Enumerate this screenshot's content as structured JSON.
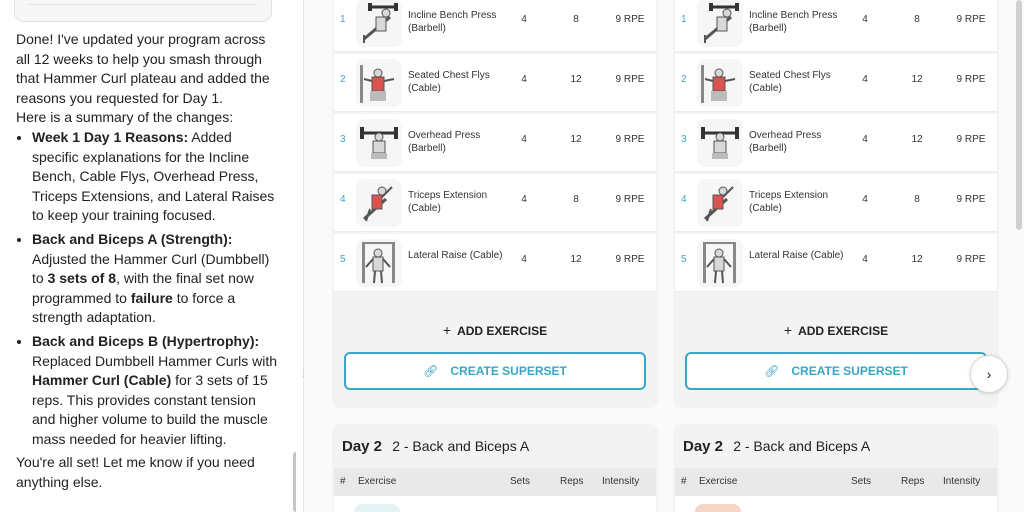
{
  "chat": {
    "intro": "Done! I've updated your program across all 12 weeks to help you smash through that Hammer Curl plateau and added the reasons you requested for Day 1.",
    "summary_lead": "Here is a summary of the changes:",
    "bullets": [
      {
        "title": "Week 1 Day 1 Reasons:",
        "text": " Added specific explanations for the Incline Bench, Cable Flys, Overhead Press, Triceps Extensions, and Lateral Raises to keep your training focused."
      },
      {
        "title": "Back and Biceps A (Strength):",
        "text_a": " Adjusted the Hammer Curl (Dumbbell) to ",
        "bold_a": "3 sets of 8",
        "text_b": ", with the final set now programmed to ",
        "bold_b": "failure",
        "text_c": " to force a strength adaptation."
      },
      {
        "title": "Back and Biceps B (Hypertrophy):",
        "text_a": " Replaced Dumbbell Hammer Curls with ",
        "bold_a": "Hammer Curl (Cable)",
        "text_b": " for 3 sets of 15 reps. This provides constant tension and higher volume to build the muscle mass needed for heavier lifting."
      }
    ],
    "closing": "You're all set! Let me know if you need anything else."
  },
  "columns": [
    {
      "exercises": [
        {
          "num": "1",
          "name": "Incline Bench Press (Barbell)",
          "sets": "4",
          "reps": "8",
          "intensity": "9 RPE",
          "icon": "incline-bench-figure"
        },
        {
          "num": "2",
          "name": "Seated Chest Flys (Cable)",
          "sets": "4",
          "reps": "12",
          "intensity": "9 RPE",
          "icon": "chest-fly-figure"
        },
        {
          "num": "3",
          "name": "Overhead Press (Barbell)",
          "sets": "4",
          "reps": "12",
          "intensity": "9 RPE",
          "icon": "overhead-press-figure"
        },
        {
          "num": "4",
          "name": "Triceps Extension (Cable)",
          "sets": "4",
          "reps": "8",
          "intensity": "9 RPE",
          "icon": "triceps-extension-figure"
        },
        {
          "num": "5",
          "name": "Lateral Raise (Cable)",
          "sets": "4",
          "reps": "12",
          "intensity": "9 RPE",
          "icon": "lateral-raise-figure"
        }
      ],
      "add_exercise": "ADD EXERCISE",
      "create_superset": "CREATE SUPERSET",
      "next_day": {
        "label": "Day 2",
        "name": "2 - Back and Biceps A"
      },
      "table_headers": {
        "num": "#",
        "exercise": "Exercise",
        "sets": "Sets",
        "reps": "Reps",
        "intensity": "Intensity"
      },
      "next_thumb_color": "#e3f2f2"
    },
    {
      "exercises": [
        {
          "num": "1",
          "name": "Incline Bench Press (Barbell)",
          "sets": "4",
          "reps": "8",
          "intensity": "9 RPE",
          "icon": "incline-bench-figure"
        },
        {
          "num": "2",
          "name": "Seated Chest Flys (Cable)",
          "sets": "4",
          "reps": "12",
          "intensity": "9 RPE",
          "icon": "chest-fly-figure"
        },
        {
          "num": "3",
          "name": "Overhead Press (Barbell)",
          "sets": "4",
          "reps": "12",
          "intensity": "9 RPE",
          "icon": "overhead-press-figure"
        },
        {
          "num": "4",
          "name": "Triceps Extension (Cable)",
          "sets": "4",
          "reps": "8",
          "intensity": "9 RPE",
          "icon": "triceps-extension-figure"
        },
        {
          "num": "5",
          "name": "Lateral Raise (Cable)",
          "sets": "4",
          "reps": "12",
          "intensity": "9 RPE",
          "icon": "lateral-raise-figure"
        }
      ],
      "add_exercise": "ADD EXERCISE",
      "create_superset": "CREATE SUPERSET",
      "next_day": {
        "label": "Day 2",
        "name": "2 - Back and Biceps A"
      },
      "table_headers": {
        "num": "#",
        "exercise": "Exercise",
        "sets": "Sets",
        "reps": "Reps",
        "intensity": "Intensity"
      },
      "next_thumb_color": "#f6d6c4"
    }
  ],
  "accent_color": "#3aa6c4"
}
